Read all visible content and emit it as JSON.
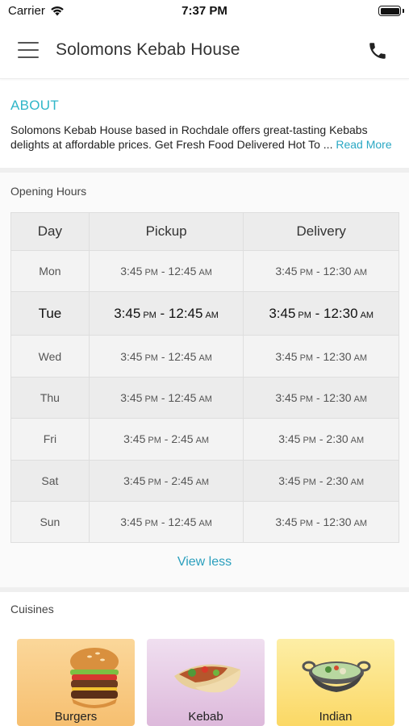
{
  "status_bar": {
    "carrier": "Carrier",
    "time": "7:37 PM",
    "battery_level": 1.0
  },
  "header": {
    "title": "Solomons Kebab House",
    "menu_icon": "hamburger-menu-icon",
    "call_icon": "phone-icon"
  },
  "about": {
    "heading": "ABOUT",
    "text": "Solomons Kebab House based in Rochdale offers great-tasting Kebabs delights at affordable prices. Get Fresh Food Delivered Hot To ...",
    "read_more": "Read More"
  },
  "opening_hours": {
    "title": "Opening Hours",
    "columns": [
      "Day",
      "Pickup",
      "Delivery"
    ],
    "rows": [
      {
        "day": "Mon",
        "pickup_start": "3:45",
        "pickup_start_ampm": "PM",
        "pickup_end": "12:45",
        "pickup_end_ampm": "AM",
        "delivery_start": "3:45",
        "delivery_start_ampm": "PM",
        "delivery_end": "12:30",
        "delivery_end_ampm": "AM"
      },
      {
        "day": "Tue",
        "pickup_start": "3:45",
        "pickup_start_ampm": "PM",
        "pickup_end": "12:45",
        "pickup_end_ampm": "AM",
        "delivery_start": "3:45",
        "delivery_start_ampm": "PM",
        "delivery_end": "12:30",
        "delivery_end_ampm": "AM"
      },
      {
        "day": "Wed",
        "pickup_start": "3:45",
        "pickup_start_ampm": "PM",
        "pickup_end": "12:45",
        "pickup_end_ampm": "AM",
        "delivery_start": "3:45",
        "delivery_start_ampm": "PM",
        "delivery_end": "12:30",
        "delivery_end_ampm": "AM"
      },
      {
        "day": "Thu",
        "pickup_start": "3:45",
        "pickup_start_ampm": "PM",
        "pickup_end": "12:45",
        "pickup_end_ampm": "AM",
        "delivery_start": "3:45",
        "delivery_start_ampm": "PM",
        "delivery_end": "12:30",
        "delivery_end_ampm": "AM"
      },
      {
        "day": "Fri",
        "pickup_start": "3:45",
        "pickup_start_ampm": "PM",
        "pickup_end": "2:45",
        "pickup_end_ampm": "AM",
        "delivery_start": "3:45",
        "delivery_start_ampm": "PM",
        "delivery_end": "2:30",
        "delivery_end_ampm": "AM"
      },
      {
        "day": "Sat",
        "pickup_start": "3:45",
        "pickup_start_ampm": "PM",
        "pickup_end": "2:45",
        "pickup_end_ampm": "AM",
        "delivery_start": "3:45",
        "delivery_start_ampm": "PM",
        "delivery_end": "2:30",
        "delivery_end_ampm": "AM"
      },
      {
        "day": "Sun",
        "pickup_start": "3:45",
        "pickup_start_ampm": "PM",
        "pickup_end": "12:45",
        "pickup_end_ampm": "AM",
        "delivery_start": "3:45",
        "delivery_start_ampm": "PM",
        "delivery_end": "12:30",
        "delivery_end_ampm": "AM"
      }
    ],
    "highlighted_day": "Tue",
    "view_less": "View less"
  },
  "cuisines": {
    "title": "Cuisines",
    "items": [
      {
        "label": "Burgers",
        "icon": "burger-image"
      },
      {
        "label": "Kebab",
        "icon": "kebab-wrap-image"
      },
      {
        "label": "Indian",
        "icon": "curry-bowl-image"
      }
    ]
  },
  "colors": {
    "accent": "#2fb6c8",
    "link": "#2a9fbd"
  }
}
